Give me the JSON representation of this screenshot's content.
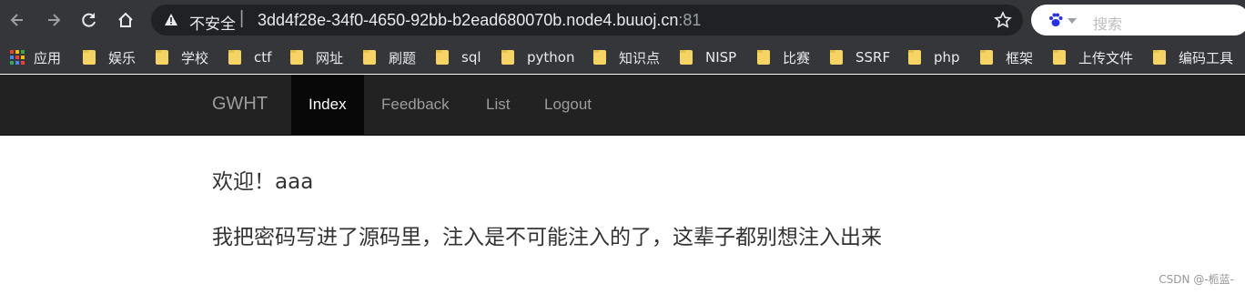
{
  "browser": {
    "security_label": "不安全",
    "separator": "|",
    "url_host": "3dd4f28e-34f0-4650-92bb-b2ead680070b.node4.buuoj.cn",
    "url_port": ":81",
    "search_placeholder": "搜索",
    "icons": [
      "back-arrow-icon",
      "forward-arrow-icon",
      "reload-icon",
      "home-icon",
      "warning-icon",
      "star-icon",
      "baidu-paw-icon"
    ]
  },
  "bookmarks": {
    "apps_label": "应用",
    "folders": [
      "娱乐",
      "学校",
      "ctf",
      "网址",
      "刷题",
      "sql",
      "python",
      "知识点",
      "NISP",
      "比赛",
      "SSRF",
      "php",
      "框架",
      "上传文件",
      "编码工具"
    ]
  },
  "navbar": {
    "brand": "GWHT",
    "items": [
      {
        "label": "Index",
        "active": true
      },
      {
        "label": "Feedback",
        "active": false
      },
      {
        "label": "List",
        "active": false
      },
      {
        "label": "Logout",
        "active": false
      }
    ]
  },
  "content": {
    "welcome": "欢迎！aaa",
    "message": "我把密码写进了源码里，注入是不可能注入的了，这辈子都别想注入出来"
  },
  "watermark": "CSDN @-栀蓝-",
  "colors": {
    "browser_chrome": "#35363a",
    "navbar_bg": "#222222",
    "navbar_active_bg": "#080808",
    "nav_text": "#9d9d9d",
    "body_text": "#333333"
  }
}
